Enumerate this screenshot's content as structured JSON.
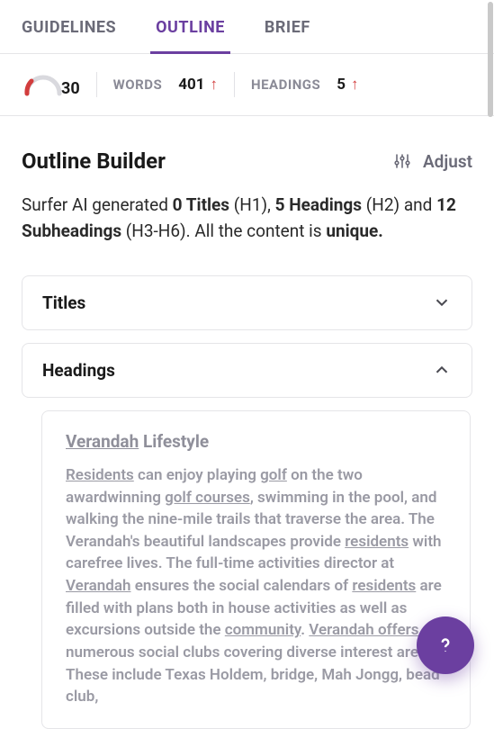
{
  "tabs": {
    "guidelines": "GUIDELINES",
    "outline": "OUTLINE",
    "brief": "BRIEF"
  },
  "stats": {
    "score": "30",
    "words_label": "WORDS",
    "words_value": "401",
    "headings_label": "HEADINGS",
    "headings_value": "5"
  },
  "header": {
    "title": "Outline Builder",
    "adjust_label": "Adjust"
  },
  "summary": {
    "pre": "Surfer AI generated ",
    "titles_count": "0 Titles",
    "titles_suffix": " (H1), ",
    "headings_count": "5 Headings",
    "headings_suffix": " (H2) and ",
    "subheadings_count": "12 Subheadings",
    "subheadings_suffix": " (H3-H6). All the content is ",
    "unique": "unique."
  },
  "accordions": {
    "titles_label": "Titles",
    "headings_label": "Headings"
  },
  "card": {
    "title_link": "Verandah",
    "title_rest": " Lifestyle",
    "body": {
      "t1": "Residents",
      "t2": " can enjoy playing ",
      "t3": "golf",
      "t4": " on the two awardwinning ",
      "t5": "golf courses",
      "t6": ", swimming in the pool, and walking the nine-mile trails that traverse the area. The Verandah's beautiful landscapes provide ",
      "t7": "residents",
      "t8": " with carefree lives. The full-time activities director at ",
      "t9": "Verandah",
      "t10": " ensures the social calendars of ",
      "t11": "residents",
      "t12": " are filled with plans both in house activities as well as excursions outside the ",
      "t13": "community",
      "t14": ". ",
      "t15": "Verandah offers",
      "t16": " numerous social clubs covering diverse interest areas. These include Texas Holdem, bridge, Mah Jongg, bead club,"
    }
  }
}
